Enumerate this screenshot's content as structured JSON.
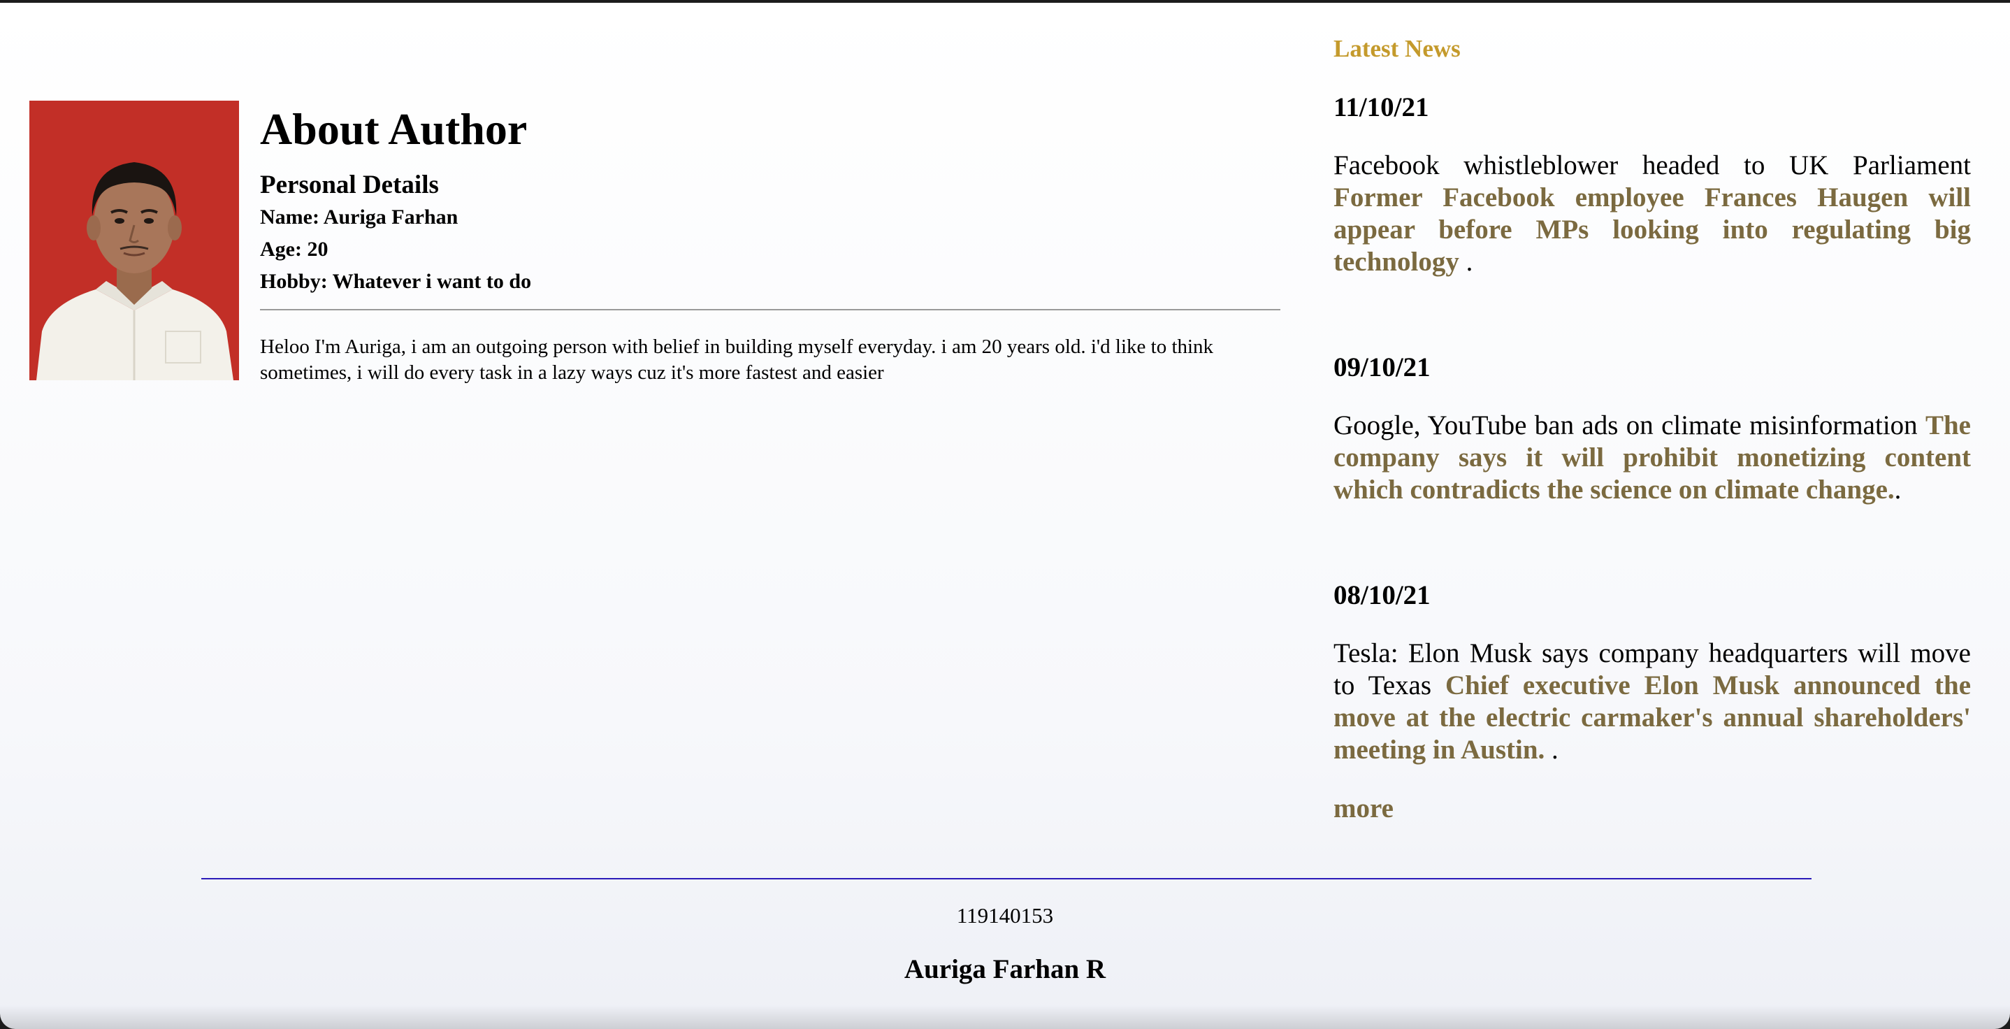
{
  "author": {
    "photo_alt": "author-portrait",
    "title": "About Author",
    "subtitle": "Personal Details",
    "details": [
      "Name: Auriga Farhan",
      "Age: 20",
      "Hobby: Whatever i want to do"
    ],
    "bio": "Heloo I'm Auriga, i am an outgoing person with belief in building myself everyday. i am 20 years old. i'd like to think sometimes, i will do every task in a lazy ways cuz it's more fastest and easier"
  },
  "news": {
    "heading": "Latest News",
    "items": [
      {
        "date": "11/10/21",
        "headline": "Facebook whistleblower headed to UK Parliament",
        "summary": "Former Facebook employee Frances Haugen will appear before MPs looking into regulating big technology",
        "trail": " ."
      },
      {
        "date": "09/10/21",
        "headline": "Google, YouTube ban ads on climate misinformation",
        "summary": "The company says it will prohibit monetizing content which contradicts the science on climate change.",
        "trail": "."
      },
      {
        "date": "08/10/21",
        "headline": "Tesla: Elon Musk says company headquarters will move to Texas",
        "summary": "Chief executive Elon Musk announced the move at the electric carmaker's annual shareholders' meeting in Austin.",
        "trail": " ."
      }
    ],
    "more_label": "more"
  },
  "footer": {
    "student_id": "119140153",
    "name": "Auriga Farhan R"
  },
  "colors": {
    "news_heading": "#c49a2c",
    "news_summary": "#7b6a40",
    "footer_rule": "#2b1bb8",
    "photo_background": "#c22f27"
  }
}
